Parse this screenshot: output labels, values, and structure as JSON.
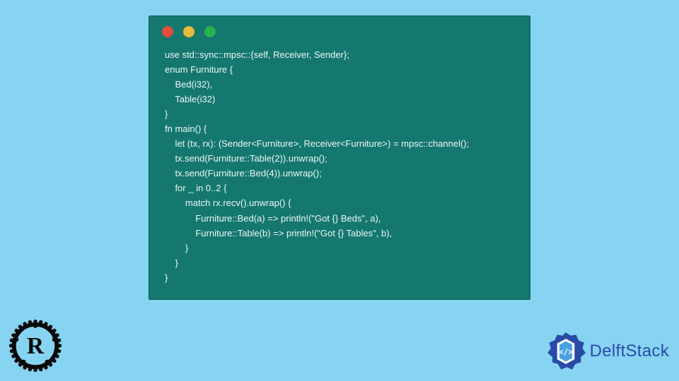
{
  "window": {
    "traffic_lights": [
      "red",
      "yellow",
      "green"
    ]
  },
  "code": {
    "lines": [
      "use std::sync::mpsc::{self, Receiver, Sender};",
      "enum Furniture {",
      "    Bed(i32),",
      "    Table(i32)",
      "}",
      "fn main() {",
      "    let (tx, rx): (Sender<Furniture>, Receiver<Furniture>) = mpsc::channel();",
      "    tx.send(Furniture::Table(2)).unwrap();",
      "    tx.send(Furniture::Bed(4)).unwrap();",
      "    for _ in 0..2 {",
      "        match rx.recv().unwrap() {",
      "            Furniture::Bed(a) => println!(\"Got {} Beds\", a),",
      "            Furniture::Table(b) => println!(\"Got {} Tables\", b),",
      "        }",
      "    }",
      "}"
    ]
  },
  "branding": {
    "rust_logo_alt": "Rust",
    "site_name": "DelftStack"
  }
}
